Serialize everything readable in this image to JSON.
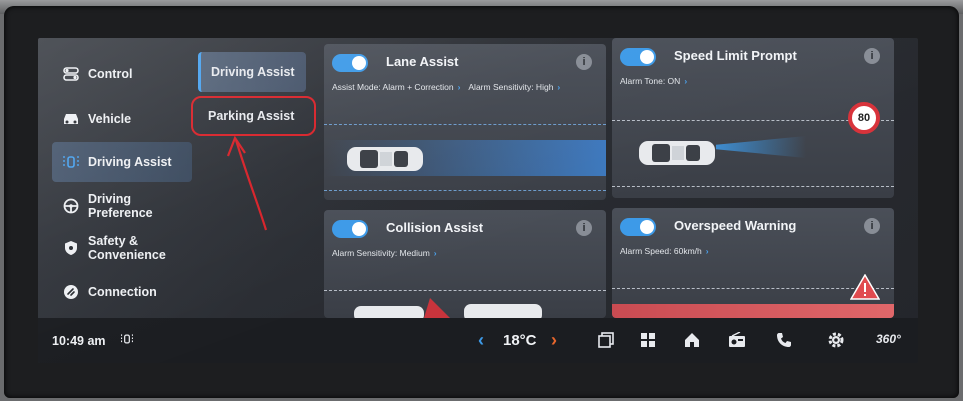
{
  "sidebar": {
    "items": [
      {
        "label": "Control",
        "icon": "control-icon"
      },
      {
        "label": "Vehicle",
        "icon": "car-icon"
      },
      {
        "label": "Driving Assist",
        "icon": "driving-assist-icon",
        "active": true
      },
      {
        "label_line1": "Driving",
        "label_line2": "Preference",
        "icon": "steering-wheel-icon"
      },
      {
        "label_line1": "Safety &",
        "label_line2": "Convenience",
        "icon": "shield-icon"
      },
      {
        "label": "Connection",
        "icon": "connection-icon"
      }
    ]
  },
  "submenu": {
    "items": [
      {
        "label": "Driving Assist",
        "active": true
      },
      {
        "label": "Parking Assist",
        "highlighted_annotation": true
      }
    ]
  },
  "cards": {
    "lane_assist": {
      "title": "Lane Assist",
      "enabled": true,
      "mode_label": "Assist Mode: Alarm + Correction",
      "sensitivity_label": "Alarm Sensitivity: High"
    },
    "speed_limit": {
      "title": "Speed Limit Prompt",
      "enabled": true,
      "tone_label": "Alarm Tone: ON",
      "sign_value": "80"
    },
    "collision": {
      "title": "Collision Assist",
      "enabled": true,
      "sensitivity_label": "Alarm Sensitivity: Medium"
    },
    "overspeed": {
      "title": "Overspeed Warning",
      "enabled": true,
      "speed_label": "Alarm Speed: 60km/h"
    },
    "info_glyph": "i"
  },
  "statusbar": {
    "time": "10:49 am",
    "temperature": "18°C",
    "icons": [
      "driving-assist-icon",
      "window-icon",
      "grid-icon",
      "home-icon",
      "radio-icon",
      "phone-icon",
      "settings-icon",
      "360-view-icon"
    ],
    "view_label": "360°"
  },
  "colors": {
    "accent": "#3d9ae8",
    "annotation_red": "#d8232a",
    "temp_right_arrow": "#e8662c"
  }
}
